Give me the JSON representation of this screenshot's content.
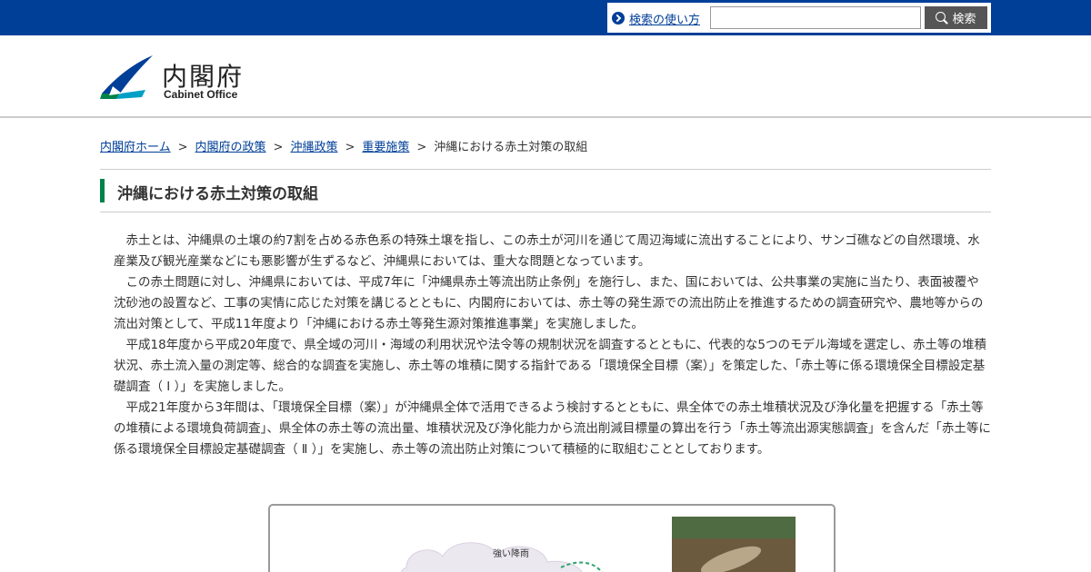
{
  "topbar": {
    "help_link": "検索の使い方",
    "search_placeholder": "",
    "search_button": "検索"
  },
  "logo": {
    "ja": "内閣府",
    "en": "Cabinet Office"
  },
  "breadcrumb": [
    {
      "label": "内閣府ホーム",
      "link": true
    },
    {
      "label": "内閣府の政策",
      "link": true
    },
    {
      "label": "沖縄政策",
      "link": true
    },
    {
      "label": "重要施策",
      "link": true
    },
    {
      "label": "沖縄における赤土対策の取組",
      "link": false
    }
  ],
  "breadcrumb_sep": ">",
  "page_title": "沖縄における赤土対策の取組",
  "paragraphs": [
    "赤土とは、沖縄県の土壌の約7割を占める赤色系の特殊土壌を指し、この赤土が河川を通じて周辺海域に流出することにより、サンゴ礁などの自然環境、水産業及び観光産業などにも悪影響が生ずるなど、沖縄県においては、重大な問題となっています。",
    "この赤土問題に対し、沖縄県においては、平成7年に「沖縄県赤土等流出防止条例」を施行し、また、国においては、公共事業の実施に当たり、表面被覆や沈砂池の設置など、工事の実情に応じた対策を講じるとともに、内閣府においては、赤土等の発生源での流出防止を推進するための調査研究や、農地等からの流出対策として、平成11年度より「沖縄における赤土等発生源対策推進事業」を実施しました。",
    "平成18年度から平成20年度で、県全域の河川・海域の利用状況や法令等の規制状況を調査するとともに、代表的な5つのモデル海域を選定し、赤土等の堆積状況、赤土流入量の測定等、総合的な調査を実施し、赤土等の堆積に関する指針である「環境保全目標（案）」を策定した、「赤土等に係る環境保全目標設定基礎調査（ Ⅰ ）」を実施しました。",
    "平成21年度から3年間は、「環境保全目標（案）」が沖縄県全体で活用できるよう検討するとともに、県全体での赤土堆積状況及び浄化量を把握する「赤土等の堆積による環境負荷調査」、県全体の赤土等の流出量、堆積状況及び浄化能力から流出削減目標量の算出を行う「赤土等流出源実態調査」を含んだ「赤土等に係る環境保全目標設定基礎調査（ Ⅱ ）」を実施し、赤土等の流出防止対策について積極的に取組むこととしております。"
  ],
  "figure": {
    "label": "強い降雨"
  },
  "colors": {
    "brand_blue": "#003f98",
    "accent_green": "#00824a"
  }
}
